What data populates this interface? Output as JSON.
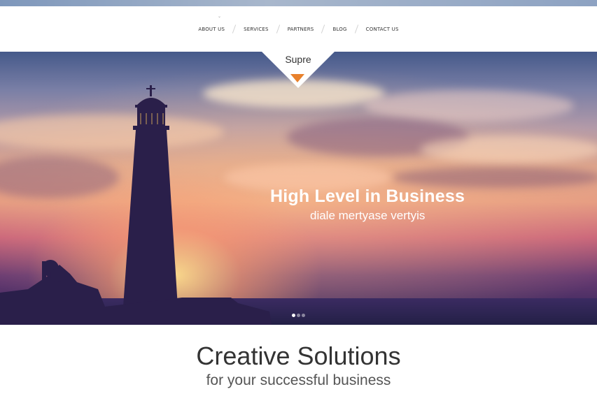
{
  "nav": {
    "items": [
      {
        "label": "ABOUT US"
      },
      {
        "label": "SERVICES"
      },
      {
        "label": "PARTNERS"
      },
      {
        "label": "BLOG"
      },
      {
        "label": "CONTACT US"
      }
    ]
  },
  "logo": {
    "text": "Supre"
  },
  "hero": {
    "title": "High Level in Business",
    "subtitle": "diale mertyase vertyis",
    "slides": {
      "count": 3,
      "active_index": 0
    }
  },
  "intro": {
    "title": "Creative Solutions",
    "subtitle": "for your successful business"
  },
  "colors": {
    "accent": "#e8812c",
    "nav_text": "#333333"
  }
}
